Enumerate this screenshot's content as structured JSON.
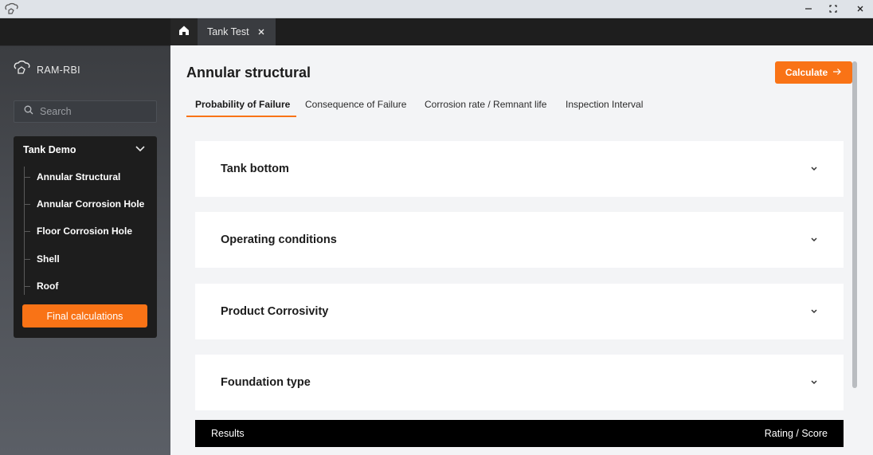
{
  "window": {
    "logo_icon": "brain-hand-icon",
    "controls": {
      "minimize_icon": "minimize-icon",
      "maximize_icon": "maximize-icon",
      "close_icon": "close-icon"
    }
  },
  "sidebar": {
    "brand_name": "RAM-RBI",
    "search": {
      "placeholder": "Search",
      "value": ""
    },
    "project": {
      "title": "Tank Demo",
      "expanded": true,
      "items": [
        {
          "label": "Annular Structural"
        },
        {
          "label": "Annular Corrosion Hole"
        },
        {
          "label": "Floor Corrosion Hole"
        },
        {
          "label": "Shell"
        },
        {
          "label": "Roof"
        }
      ],
      "final_button_label": "Final calculations"
    }
  },
  "tabstrip": {
    "home_icon": "home-icon",
    "tabs": [
      {
        "label": "Tank Test",
        "closable": true
      }
    ]
  },
  "main": {
    "title": "Annular structural",
    "calculate_label": "Calculate",
    "tabs": [
      {
        "label": "Probability of Failure",
        "active": true
      },
      {
        "label": "Consequence of Failure",
        "active": false
      },
      {
        "label": "Corrosion rate / Remnant life",
        "active": false
      },
      {
        "label": "Inspection Interval",
        "active": false
      }
    ],
    "sections": [
      {
        "title": "Tank bottom"
      },
      {
        "title": "Operating conditions"
      },
      {
        "title": "Product Corrosivity"
      },
      {
        "title": "Foundation type"
      }
    ],
    "results": {
      "left": "Results",
      "right": "Rating / Score"
    }
  },
  "colors": {
    "accent": "#f97316",
    "sidebar_panel": "#1d1d1d",
    "content_bg": "#f3f4f6",
    "results_bar": "#000000"
  }
}
